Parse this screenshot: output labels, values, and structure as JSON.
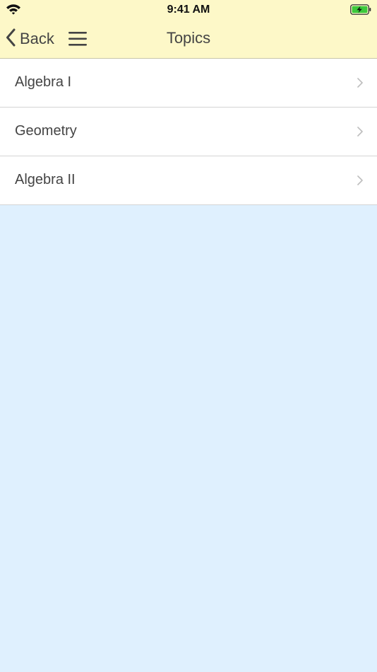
{
  "status_bar": {
    "time": "9:41 AM",
    "wifi_icon": "wifi-icon",
    "battery_icon": "battery-charging-icon",
    "battery_color": "#3cc93c"
  },
  "nav": {
    "back_label": "Back",
    "back_icon": "chevron-left-icon",
    "menu_icon": "hamburger-menu-icon",
    "title": "Topics"
  },
  "topics": [
    {
      "label": "Algebra I"
    },
    {
      "label": "Geometry"
    },
    {
      "label": "Algebra II"
    }
  ],
  "colors": {
    "header_bg": "#fdf8c8",
    "content_bg": "#dff0fe",
    "text": "#444444"
  }
}
